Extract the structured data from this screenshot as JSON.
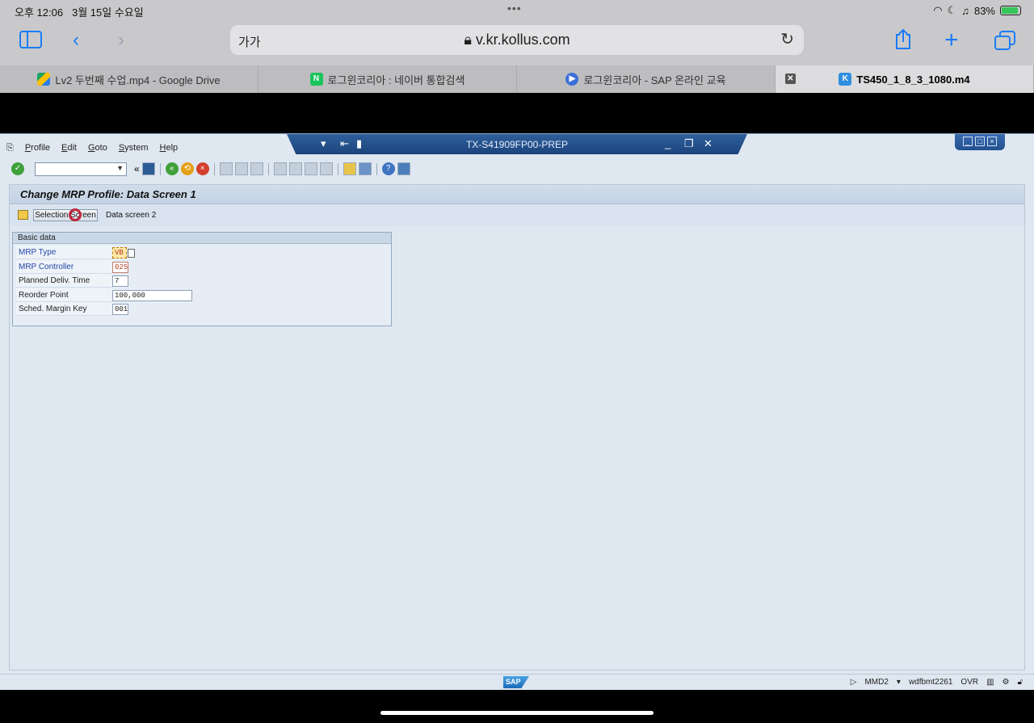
{
  "status": {
    "time": "오후 12:06",
    "date": "3월 15일 수요일",
    "battery": "83%"
  },
  "safari": {
    "text_size": "가가",
    "url": "v.kr.kollus.com"
  },
  "tabs": [
    {
      "label": "Lv2 두번째 수업.mp4 - Google Drive"
    },
    {
      "label": "로그윈코리아 : 네이버 통합검색"
    },
    {
      "label": "로그윈코리아 - SAP 온라인 교육"
    },
    {
      "label": "TS450_1_8_3_1080.m4"
    }
  ],
  "sap": {
    "window_title": "TX-S41909FP00-PREP",
    "menu": [
      "Profile",
      "Edit",
      "Goto",
      "System",
      "Help"
    ],
    "page_title": "Change MRP Profile: Data Screen 1",
    "app_toolbar": {
      "selection_screen": "Selection Screen",
      "data_screen_2": "Data screen 2"
    },
    "group_title": "Basic data",
    "fields": [
      {
        "label": "MRP Type",
        "value": "VB"
      },
      {
        "label": "MRP Controller",
        "value": "025"
      },
      {
        "label": "Planned Deliv. Time",
        "value": "7"
      },
      {
        "label": "Reorder Point",
        "value": "100,000"
      },
      {
        "label": "Sched. Margin Key",
        "value": "001"
      }
    ],
    "statusbar": {
      "tx": "MMD2",
      "server": "wdfbmt2261",
      "mode": "OVR"
    }
  },
  "colors": {
    "accent": "#1b447c",
    "required_label": "#2446a8",
    "battery": "#35c759"
  }
}
